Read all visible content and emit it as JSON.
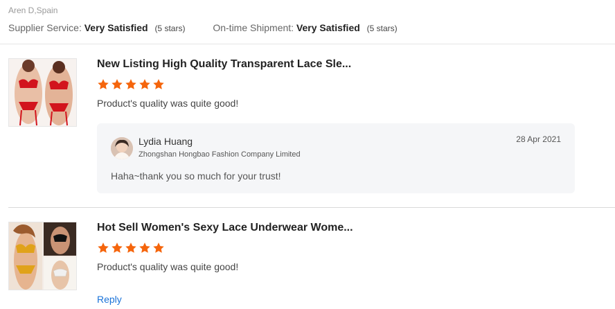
{
  "header": {
    "reviewer": "Aren D,Spain",
    "supplier_service": {
      "label": "Supplier Service:",
      "value": "Very Satisfied",
      "stars": "(5 stars)"
    },
    "ontime_shipment": {
      "label": "On-time Shipment:",
      "value": "Very Satisfied",
      "stars": "(5 stars)"
    }
  },
  "reviews": [
    {
      "product_title": "New Listing High Quality Transparent Lace Sle...",
      "rating": 5,
      "comment": "Product's quality was quite good!",
      "reply": {
        "name": "Lydia Huang",
        "company": "Zhongshan Hongbao Fashion Company Limited",
        "date": "28 Apr 2021",
        "text": "Haha~thank you so much for your trust!"
      }
    },
    {
      "product_title": "Hot Sell Women's Sexy Lace Underwear Wome...",
      "rating": 5,
      "comment": "Product's quality was quite good!",
      "reply_link": "Reply"
    }
  ],
  "colors": {
    "star": "#f5650c",
    "link": "#1a73d9",
    "reply_bg": "#f5f6f8"
  }
}
